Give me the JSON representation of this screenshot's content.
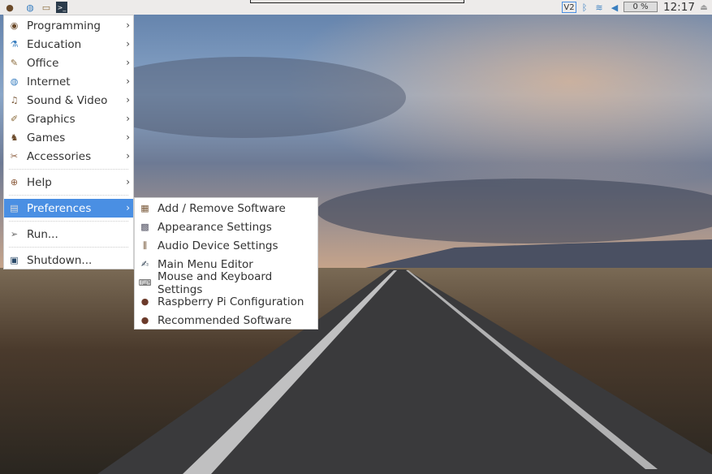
{
  "panel": {
    "network_indicator": "V2",
    "battery_text": "0 %",
    "clock": "12:17"
  },
  "menu": {
    "items": [
      {
        "label": "Programming",
        "icon": "programming-icon",
        "glyph": "◉",
        "color": "#6b4a2a",
        "submenu": true
      },
      {
        "label": "Education",
        "icon": "education-icon",
        "glyph": "⚗",
        "color": "#3a7fc0",
        "submenu": true
      },
      {
        "label": "Office",
        "icon": "office-icon",
        "glyph": "✎",
        "color": "#8a6a3a",
        "submenu": true
      },
      {
        "label": "Internet",
        "icon": "globe-icon",
        "glyph": "◍",
        "color": "#3a7fc0",
        "submenu": true
      },
      {
        "label": "Sound & Video",
        "icon": "sound-video-icon",
        "glyph": "♫",
        "color": "#7a5a3a",
        "submenu": true
      },
      {
        "label": "Graphics",
        "icon": "graphics-icon",
        "glyph": "✐",
        "color": "#8a6a3a",
        "submenu": true
      },
      {
        "label": "Games",
        "icon": "games-icon",
        "glyph": "♞",
        "color": "#6b4a2a",
        "submenu": true
      },
      {
        "label": "Accessories",
        "icon": "accessories-icon",
        "glyph": "✂",
        "color": "#8a5a3a",
        "submenu": true
      },
      {
        "label": "Help",
        "icon": "help-icon",
        "glyph": "⊕",
        "color": "#8a5a3a",
        "submenu": true
      },
      {
        "label": "Preferences",
        "icon": "preferences-icon",
        "glyph": "▤",
        "color": "#ddd",
        "submenu": true
      },
      {
        "label": "Run...",
        "icon": "run-icon",
        "glyph": "➢",
        "color": "#666",
        "submenu": false
      },
      {
        "label": "Shutdown...",
        "icon": "shutdown-icon",
        "glyph": "▣",
        "color": "#2a4a6a",
        "submenu": false
      }
    ]
  },
  "submenu": {
    "items": [
      {
        "label": "Add / Remove Software",
        "icon": "package-icon",
        "glyph": "▦",
        "color": "#7a5a3a"
      },
      {
        "label": "Appearance Settings",
        "icon": "appearance-icon",
        "glyph": "▩",
        "color": "#556"
      },
      {
        "label": "Audio Device Settings",
        "icon": "audio-settings-icon",
        "glyph": "⫼",
        "color": "#6b4a2a"
      },
      {
        "label": "Main Menu Editor",
        "icon": "menu-editor-icon",
        "glyph": "✍",
        "color": "#345"
      },
      {
        "label": "Mouse and Keyboard Settings",
        "icon": "keyboard-icon",
        "glyph": "⌨",
        "color": "#555"
      },
      {
        "label": "Raspberry Pi Configuration",
        "icon": "raspberry-icon",
        "glyph": "●",
        "color": "#6b3a2a"
      },
      {
        "label": "Recommended Software",
        "icon": "raspberry-icon",
        "glyph": "●",
        "color": "#6b3a2a"
      }
    ]
  }
}
